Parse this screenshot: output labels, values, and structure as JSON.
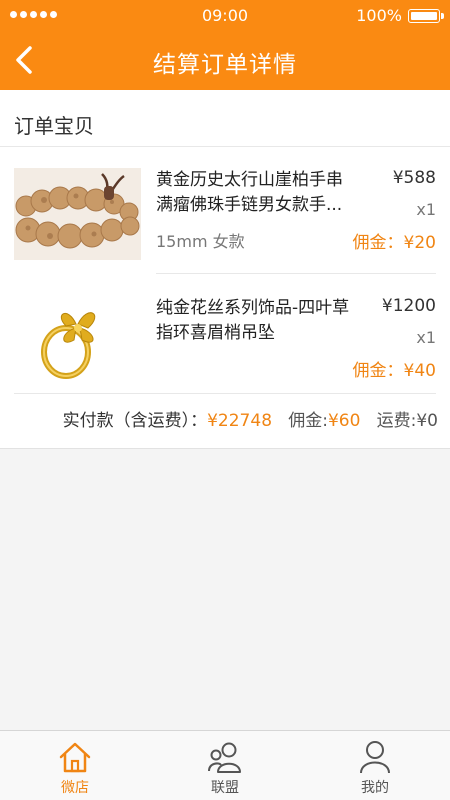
{
  "status_bar": {
    "time": "09:00",
    "battery": "100%"
  },
  "header": {
    "title": "结算订单详情"
  },
  "section": {
    "title": "订单宝贝"
  },
  "items": [
    {
      "name": "黄金历史太行山崖柏手串满瘤佛珠手链男女款手...",
      "spec": "15mm 女款",
      "price": "¥588",
      "qty": "x1",
      "commission": "佣金：¥20"
    },
    {
      "name": "纯金花丝系列饰品-四叶草指环喜眉梢吊坠",
      "spec": "",
      "price": "¥1200",
      "qty": "x1",
      "commission": "佣金：¥40"
    }
  ],
  "summary": {
    "paid_label": "实付款（含运费）：",
    "paid_value": "¥22748",
    "commission_label": "佣金:",
    "commission_value": "¥60",
    "shipping": "运费:¥0"
  },
  "tabs": [
    {
      "label": "微店",
      "icon": "home-icon",
      "active": true
    },
    {
      "label": "联盟",
      "icon": "group-icon",
      "active": false
    },
    {
      "label": "我的",
      "icon": "user-icon",
      "active": false
    }
  ],
  "colors": {
    "brand": "#fa8a12",
    "accent": "#f08514"
  }
}
